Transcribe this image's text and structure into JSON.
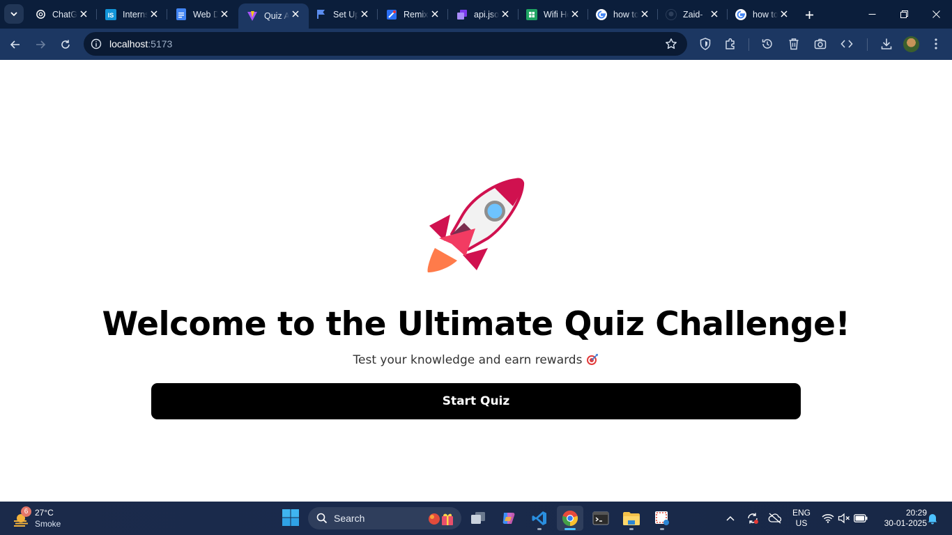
{
  "browser": {
    "tabs": [
      {
        "title": "ChatGPT",
        "icon": "openai-icon"
      },
      {
        "title": "Internshala",
        "icon": "internshala-icon"
      },
      {
        "title": "Web Dev",
        "icon": "google-docs-icon"
      },
      {
        "title": "Quiz App",
        "icon": "vite-icon",
        "active": true
      },
      {
        "title": "Set Up",
        "icon": "flag-icon"
      },
      {
        "title": "Remix",
        "icon": "remix-icon"
      },
      {
        "title": "api.json",
        "icon": "api-icon"
      },
      {
        "title": "Wifi Hotspot",
        "icon": "sheets-icon"
      },
      {
        "title": "how to",
        "icon": "google-icon"
      },
      {
        "title": "Zaid-",
        "icon": "github-icon"
      },
      {
        "title": "how to",
        "icon": "google-icon"
      }
    ],
    "address": {
      "host": "localhost",
      "port": ":5173"
    }
  },
  "page": {
    "title": "Welcome to the Ultimate Quiz Challenge!",
    "subtitle": "Test your knowledge and earn rewards",
    "start_button": "Start Quiz",
    "hero_icon": "rocket-icon"
  },
  "taskbar": {
    "weather": {
      "temp": "27°C",
      "condition": "Smoke",
      "badge": "6"
    },
    "search_label": "Search",
    "language": {
      "line1": "ENG",
      "line2": "US"
    },
    "clock": {
      "time": "20:29",
      "date": "30-01-2025"
    }
  },
  "colors": {
    "tabstrip": "#0b1e3b",
    "toolbar": "#1c3762",
    "button": "#000000",
    "rocket_red": "#d0114f",
    "rocket_body": "#f2f2f2"
  }
}
